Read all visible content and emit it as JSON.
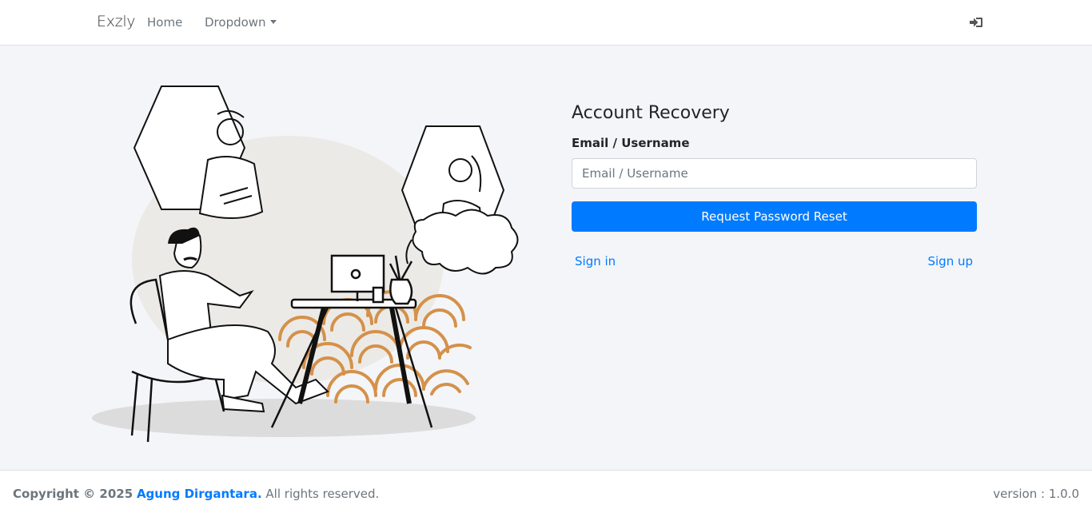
{
  "nav": {
    "brand": "Exzly",
    "home": "Home",
    "dropdown": "Dropdown",
    "signin_icon": "sign-in-icon"
  },
  "form": {
    "title": "Account Recovery",
    "label": "Email / Username",
    "placeholder": "Email / Username",
    "value": "",
    "submit": "Request Password Reset",
    "signin": "Sign in",
    "signup": "Sign up"
  },
  "footer": {
    "copyright_prefix": "Copyright © 2025",
    "author": "Agung Dirgantara.",
    "rights": "All rights reserved.",
    "version": "version : 1.0.0"
  },
  "colors": {
    "primary": "#007bff",
    "background": "#f4f5f8",
    "illustration_accent": "#d4914a"
  },
  "illustration": {
    "name": "team-conversation-illustration"
  }
}
